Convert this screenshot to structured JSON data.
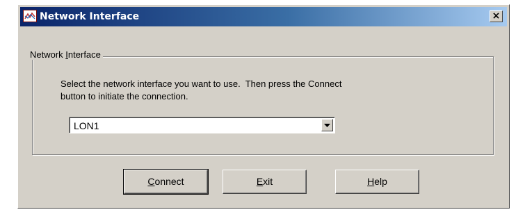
{
  "window": {
    "title": "Network Interface",
    "close_glyph": "×",
    "icon": "network-app-icon"
  },
  "group": {
    "legend_pre": "Network ",
    "legend_mn": "I",
    "legend_post": "nterface",
    "instruction_line1": "Select the network interface you want to use.  Then press the Connect",
    "instruction_line2": "button to initiate the connection."
  },
  "combo": {
    "selected": "LON1"
  },
  "buttons": {
    "connect": {
      "mn": "C",
      "rest": "onnect"
    },
    "exit": {
      "mn": "E",
      "rest": "xit"
    },
    "help": {
      "mn": "H",
      "rest": "elp"
    }
  }
}
